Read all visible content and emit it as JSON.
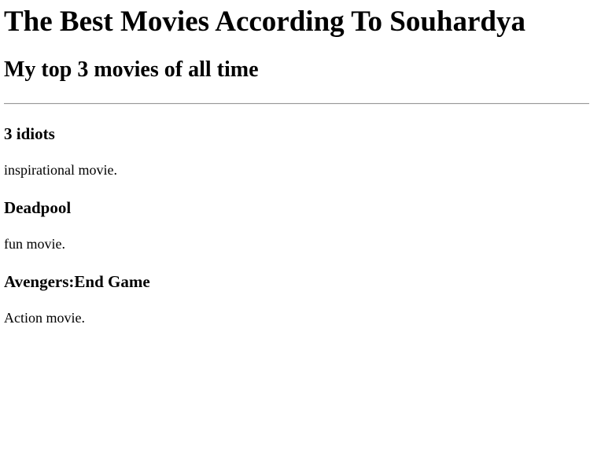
{
  "page": {
    "title": "The Best Movies According To Souhardya",
    "subtitle": "My top 3 movies of all time"
  },
  "movies": [
    {
      "title": "3 idiots",
      "description": "inspirational movie."
    },
    {
      "title": "Deadpool",
      "description": "fun movie."
    },
    {
      "title": "Avengers:End Game",
      "description": "Action movie."
    }
  ]
}
